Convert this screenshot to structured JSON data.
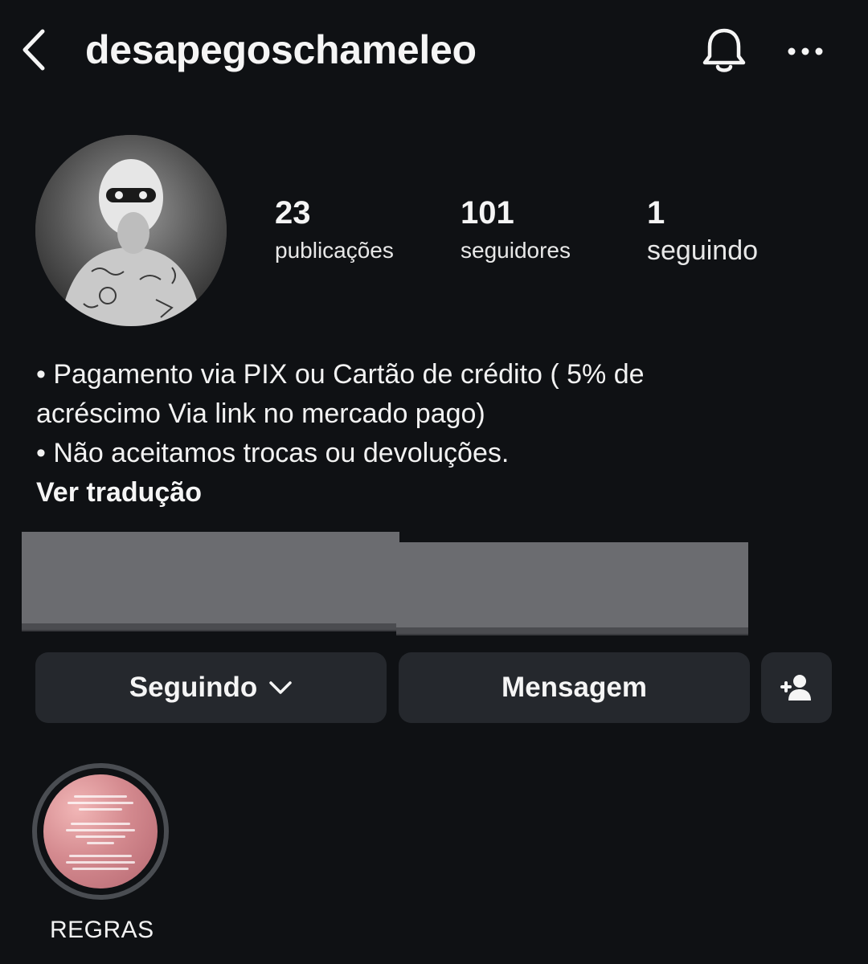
{
  "header": {
    "username": "desapegoschameleo",
    "back_icon": "chevron-left-icon",
    "notifications_icon": "bell-icon",
    "more_icon": "more-horizontal-icon"
  },
  "profile": {
    "avatar_icon": "profile-photo",
    "stats": {
      "posts": {
        "value": "23",
        "label": "publicações"
      },
      "followers": {
        "value": "101",
        "label": "seguidores"
      },
      "following": {
        "value": "1",
        "label": "seguindo"
      }
    }
  },
  "bio": {
    "lines": [
      "• Pagamento via PIX ou Cartão de crédito ( 5% de",
      "acréscimo Via link no mercado pago)",
      "• Não aceitamos trocas ou devoluções."
    ],
    "see_translation": "Ver tradução"
  },
  "actions": {
    "following_label": "Seguindo",
    "message_label": "Mensagem",
    "add_user_icon": "person-add-icon"
  },
  "highlights": [
    {
      "label": "REGRAS"
    }
  ],
  "colors": {
    "background": "#0f1114",
    "button": "#25282d",
    "text": "#f5f5f5"
  }
}
